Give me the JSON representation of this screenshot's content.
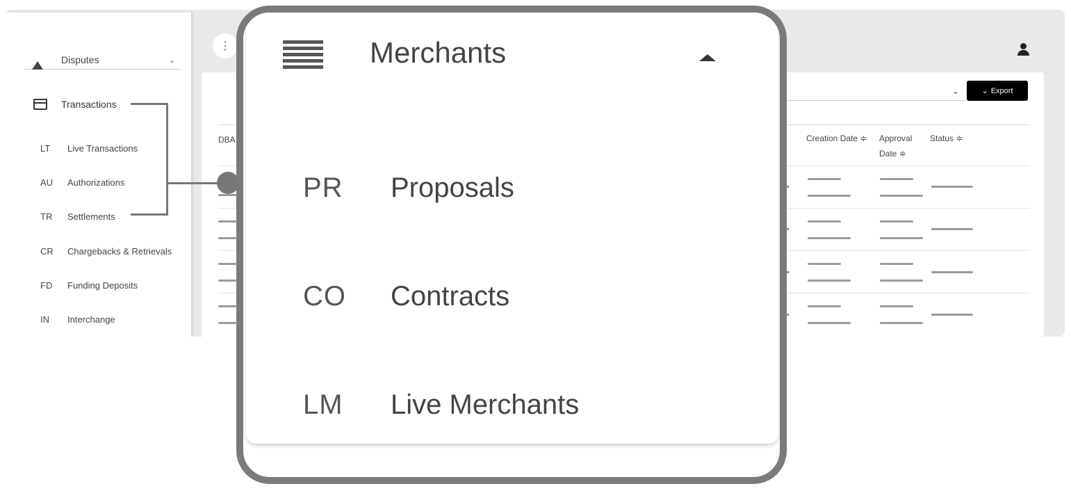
{
  "sidebar": {
    "disputes_label": "Disputes",
    "transactions_label": "Transactions",
    "sub_items": [
      {
        "abbr": "LT",
        "label": "Live Transactions"
      },
      {
        "abbr": "AU",
        "label": "Authorizations"
      },
      {
        "abbr": "TR",
        "label": "Settlements"
      },
      {
        "abbr": "CR",
        "label": "Chargebacks & Retrievals"
      },
      {
        "abbr": "FD",
        "label": "Funding Deposits"
      },
      {
        "abbr": "IN",
        "label": "Interchange"
      }
    ]
  },
  "toolbar": {
    "kebab_glyph": "⋮",
    "export_label": "Export",
    "export_chevron": "⌄",
    "filter_chevron": "⌄"
  },
  "table": {
    "headers": {
      "dba": "DBA",
      "creation_date": "Creation Date ≑",
      "approval_line1": "Approval",
      "approval_line2": "Date ≑",
      "status": "Status ≑"
    }
  },
  "zoom": {
    "menu_title": "Merchants",
    "items": [
      {
        "abbr": "PR",
        "label": "Proposals"
      },
      {
        "abbr": "CO",
        "label": "Contracts"
      },
      {
        "abbr": "LM",
        "label": "Live Merchants"
      }
    ]
  },
  "colors": {
    "callout_border": "#7a7a7a",
    "export_bg": "#000000",
    "app_bg": "#e9e9e9"
  }
}
